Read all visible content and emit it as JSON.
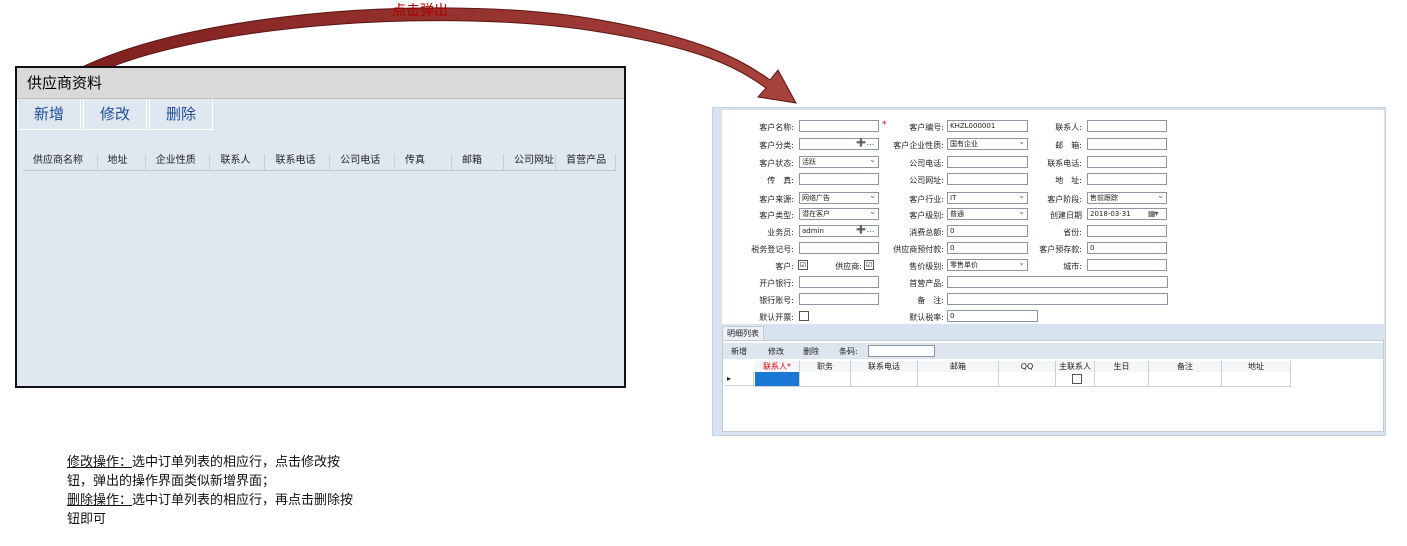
{
  "callout": {
    "label": "点击弹出"
  },
  "supplier_window": {
    "title": "供应商资料",
    "toolbar": {
      "add": "新增",
      "edit": "修改",
      "delete": "删除"
    },
    "columns": [
      "供应商名称",
      "地址",
      "企业性质",
      "联系人",
      "联系电话",
      "公司电话",
      "传真",
      "邮箱",
      "公司网址",
      "首营产品"
    ]
  },
  "customer_form": {
    "labels": {
      "name": "客户名称:",
      "code": "客户编号:",
      "contact": "联系人:",
      "category": "客户分类:",
      "enterprise_type": "客户企业性质:",
      "email": "邮　箱:",
      "status": "客户状态:",
      "company_phone": "公司电话:",
      "contact_phone": "联系电话:",
      "fax": "传　真:",
      "website": "公司网址:",
      "address": "地　址:",
      "source": "客户来源:",
      "industry": "客户行业:",
      "stage": "客户阶段:",
      "type": "客户类型:",
      "level": "客户级别:",
      "created": "创建日期",
      "salesman": "业务员:",
      "total_spend": "消费总额:",
      "province": "省份:",
      "tax_reg": "税务登记号:",
      "supplier_prepay": "供应商预付款:",
      "customer_prestore": "客户预存款:",
      "is_customer": "客户:",
      "is_supplier": "供应商:",
      "price_level": "售价级别:",
      "city": "城市:",
      "bank": "开户银行:",
      "first_product": "首营产品:",
      "bank_account": "银行账号:",
      "remark": "备　注:",
      "default_invoice": "默认开票:",
      "default_tax": "默认税率:"
    },
    "values": {
      "code": "KHZL000001",
      "enterprise_type": "国有企业",
      "status": "活跃",
      "source": "网络广告",
      "industry": "IT",
      "stage": "售前跟踪",
      "type": "潜在客户",
      "level": "普通",
      "created": "2018-03-31",
      "salesman": "admin",
      "total_spend": "0",
      "supplier_prepay": "0",
      "customer_prestore": "0",
      "price_level": "零售单价",
      "default_tax": "0",
      "is_customer_check": "☑",
      "is_supplier_check": "☑",
      "pick_glyph": "➕ …",
      "date_glyph": "▦▾"
    },
    "required_mark": "*"
  },
  "detail": {
    "tab": "明细列表",
    "toolbar": {
      "add": "新增",
      "edit": "修改",
      "delete": "删除",
      "barcode": "条码:"
    },
    "columns": [
      "联系人*",
      "职务",
      "联系电话",
      "邮箱",
      "QQ",
      "主联系人",
      "生日",
      "备注",
      "地址"
    ],
    "row_marker": "▸"
  },
  "notes": {
    "edit_title": "修改操作：",
    "edit_text": "选中订单列表的相应行，点击修改按",
    "edit_text2": "钮，弹出的操作界面类似新增界面；",
    "delete_title": "删除操作：",
    "delete_text": "选中订单列表的相应行，再点击删除按",
    "delete_text2": "钮即可"
  },
  "colors": {
    "arrow": "#9e2f2c",
    "accent_text": "#1f4e96",
    "required": "#d00000"
  }
}
